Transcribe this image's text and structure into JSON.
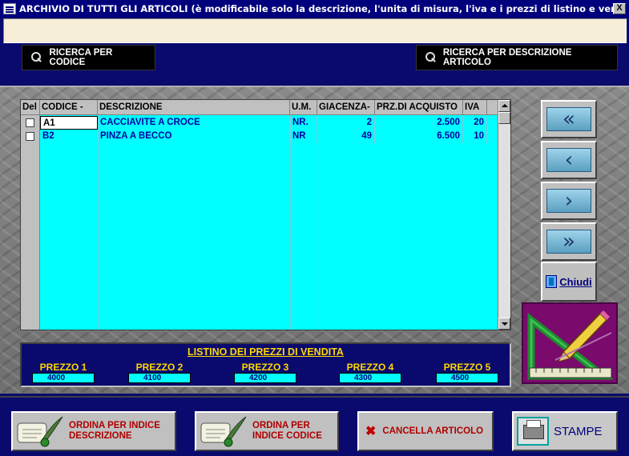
{
  "window": {
    "title": "ARCHIVIO DI TUTTI GLI ARTICOLI (è modificabile solo la descrizione, l'unita di misura, l'iva e i prezzi di listino e vendita).",
    "close_label": "X"
  },
  "search": {
    "by_code_label": "RICERCA PER CODICE",
    "by_description_label": "RICERCA PER DESCRIZIONE ARTICOLO"
  },
  "grid": {
    "columns": [
      "Del",
      "CODICE  -",
      "DESCRIZIONE",
      "U.M.",
      "GIACENZA-",
      "PRZ.DI ACQUISTO",
      "IVA"
    ],
    "rows": [
      {
        "del": false,
        "code": "A1",
        "description": "CACCIAVITE A CROCE",
        "um": "NR.",
        "stock": "2",
        "purchase_price": "2.500",
        "iva": "20"
      },
      {
        "del": false,
        "code": "B2",
        "description": "PINZA A BECCO",
        "um": "NR",
        "stock": "49",
        "purchase_price": "6.500",
        "iva": "10"
      }
    ]
  },
  "nav": {
    "first": "«",
    "prev": "‹",
    "next": "›",
    "last": "»",
    "close_label": "Chiudi"
  },
  "listino": {
    "title": "LISTINO DEI PREZZI DI VENDITA",
    "prices": [
      {
        "label": "PREZZO 1",
        "value": "4000"
      },
      {
        "label": "PREZZO 2",
        "value": "4100"
      },
      {
        "label": "PREZZO 3",
        "value": "4200"
      },
      {
        "label": "PREZZO 4",
        "value": "4300"
      },
      {
        "label": "PREZZO 5",
        "value": "4500"
      }
    ]
  },
  "actions": {
    "sort_by_description_line1": "ORDINA PER INDICE",
    "sort_by_description_line2": "DESCRIZIONE",
    "sort_by_code_line1": "ORDINA PER",
    "sort_by_code_line2": "INDICE CODICE",
    "delete_label": "CANCELLA ARTICOLO",
    "print_label": "STAMPE"
  },
  "colors": {
    "title_bar": "#00007c",
    "grid_bg": "#00ffff",
    "window_bg": "#0a0a6e",
    "price_label": "#ffd700",
    "action_text": "#b00000"
  }
}
